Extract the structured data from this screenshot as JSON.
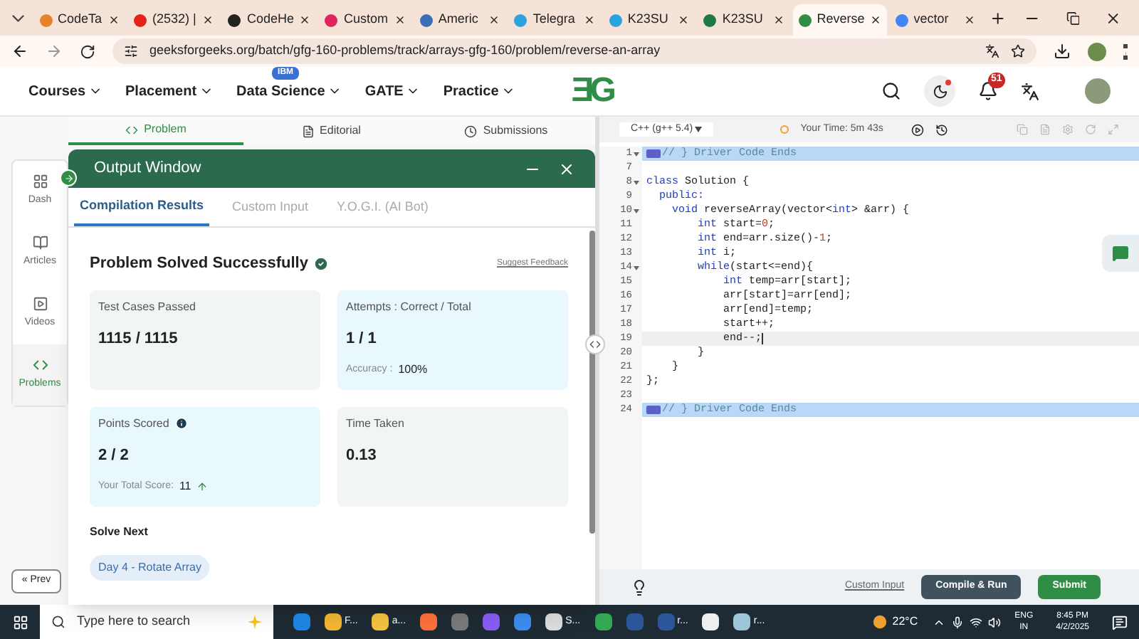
{
  "browser_tabs": [
    {
      "label": "CodeTa",
      "color": "#e8822a",
      "selected": false
    },
    {
      "label": "(2532) |",
      "color": "#e62117",
      "selected": false
    },
    {
      "label": "CodeHe",
      "color": "#222222",
      "selected": false
    },
    {
      "label": "Custom",
      "color": "#e0245e",
      "selected": false
    },
    {
      "label": "Americ",
      "color": "#3a6fb5",
      "selected": false
    },
    {
      "label": "Telegra",
      "color": "#2aa3df",
      "selected": false
    },
    {
      "label": "K23SU",
      "color": "#2aa3df",
      "selected": false
    },
    {
      "label": "K23SU",
      "color": "#1d7a45",
      "selected": false
    },
    {
      "label": "Reverse",
      "color": "#2f8d46",
      "selected": true
    },
    {
      "label": "vector",
      "color": "#4285f4",
      "selected": false
    }
  ],
  "address": "geeksforgeeks.org/batch/gfg-160-problems/track/arrays-gfg-160/problem/reverse-an-array",
  "site_nav": [
    {
      "label": "Courses"
    },
    {
      "label": "Placement"
    },
    {
      "label": "Data Science",
      "badge": "IBM"
    },
    {
      "label": "GATE"
    },
    {
      "label": "Practice"
    }
  ],
  "logo": "ƎG",
  "notifications": "51",
  "problem_tabs": [
    {
      "label": "Problem",
      "selected": true
    },
    {
      "label": "Editorial",
      "selected": false
    },
    {
      "label": "Submissions",
      "selected": false
    }
  ],
  "sidebar": [
    {
      "label": "Dash",
      "selected": false
    },
    {
      "label": "Articles",
      "selected": false
    },
    {
      "label": "Videos",
      "selected": false
    },
    {
      "label": "Problems",
      "selected": true
    }
  ],
  "prev_button": "« Prev",
  "output_window": {
    "title": "Output Window",
    "tabs": [
      {
        "label": "Compilation Results",
        "selected": true
      },
      {
        "label": "Custom Input",
        "selected": false
      },
      {
        "label": "Y.O.G.I. (AI Bot)",
        "selected": false
      }
    ],
    "heading": "Problem Solved Successfully",
    "feedback_link": "Suggest Feedback",
    "cards": [
      {
        "title": "Test Cases Passed",
        "value": "1115 / 1115",
        "color": "#f1f6f4"
      },
      {
        "title": "Attempts : Correct / Total",
        "value": "1 / 1",
        "footer_label": "Accuracy :",
        "footer_value": "100%",
        "color": "#e8f8fc"
      },
      {
        "title": "Points Scored",
        "info": true,
        "value": "2 / 2",
        "footer_label": "Your Total Score:",
        "footer_value": "11",
        "trend_up": true,
        "color": "#e8f8fc"
      },
      {
        "title": "Time Taken",
        "value": "0.13",
        "color": "#f1f6f4"
      }
    ],
    "solve_next_heading": "Solve Next",
    "solve_next": [
      "Day 4 - Rotate Array"
    ]
  },
  "editor": {
    "language": "C++ (g++ 5.4)",
    "timer": "Your Time: 5m 43s",
    "lines": [
      {
        "number": "1",
        "fold": true,
        "highlighted": true,
        "active": false,
        "segments": [
          {
            "text": "// } Driver Code Ends",
            "kind": "comment"
          }
        ]
      },
      {
        "number": "7",
        "fold": false,
        "highlighted": false,
        "active": false
      },
      {
        "number": "8",
        "fold": true,
        "highlighted": false,
        "active": false,
        "segments": [
          {
            "text": "class",
            "kind": "keyword"
          },
          {
            "text": " Solution {",
            "kind": "plain"
          }
        ]
      },
      {
        "number": "9",
        "fold": false,
        "highlighted": false,
        "active": false,
        "segments": [
          {
            "text": "  public:",
            "kind": "keyword"
          }
        ]
      },
      {
        "number": "10",
        "fold": true,
        "highlighted": false,
        "active": false,
        "segments": [
          {
            "text": "    void",
            "kind": "keyword"
          },
          {
            "text": " reverseArray(vector<",
            "kind": "plain"
          },
          {
            "text": "int",
            "kind": "keyword"
          },
          {
            "text": "> &arr) {",
            "kind": "plain"
          }
        ]
      },
      {
        "number": "11",
        "fold": false,
        "highlighted": false,
        "active": false,
        "segments": [
          {
            "text": "        int",
            "kind": "keyword"
          },
          {
            "text": " start=",
            "kind": "plain"
          },
          {
            "text": "0",
            "kind": "number"
          },
          {
            "text": ";",
            "kind": "plain"
          }
        ]
      },
      {
        "number": "12",
        "fold": false,
        "highlighted": false,
        "active": false,
        "segments": [
          {
            "text": "        int",
            "kind": "keyword"
          },
          {
            "text": " end=arr.size()-",
            "kind": "plain"
          },
          {
            "text": "1",
            "kind": "number"
          },
          {
            "text": ";",
            "kind": "plain"
          }
        ]
      },
      {
        "number": "13",
        "fold": false,
        "highlighted": false,
        "active": false,
        "segments": [
          {
            "text": "        int",
            "kind": "keyword"
          },
          {
            "text": " i;",
            "kind": "plain"
          }
        ]
      },
      {
        "number": "14",
        "fold": true,
        "highlighted": false,
        "active": false,
        "segments": [
          {
            "text": "        while",
            "kind": "keyword"
          },
          {
            "text": "(start<=end){",
            "kind": "plain"
          }
        ]
      },
      {
        "number": "15",
        "fold": false,
        "highlighted": false,
        "active": false,
        "segments": [
          {
            "text": "            int",
            "kind": "keyword"
          },
          {
            "text": " temp=arr[start];",
            "kind": "plain"
          }
        ]
      },
      {
        "number": "16",
        "fold": false,
        "highlighted": false,
        "active": false,
        "segments": [
          {
            "text": "            arr[start]=arr[end];",
            "kind": "plain"
          }
        ]
      },
      {
        "number": "17",
        "fold": false,
        "highlighted": false,
        "active": false,
        "segments": [
          {
            "text": "            arr[end]=temp;",
            "kind": "plain"
          }
        ]
      },
      {
        "number": "18",
        "fold": false,
        "highlighted": false,
        "active": false,
        "segments": [
          {
            "text": "            start++;",
            "kind": "plain"
          }
        ]
      },
      {
        "number": "19",
        "fold": false,
        "highlighted": false,
        "active": true,
        "segments": [
          {
            "text": "            end--;",
            "kind": "plain"
          }
        ]
      },
      {
        "number": "20",
        "fold": false,
        "highlighted": false,
        "active": false,
        "segments": [
          {
            "text": "        }",
            "kind": "plain"
          }
        ]
      },
      {
        "number": "21",
        "fold": false,
        "highlighted": false,
        "active": false,
        "segments": [
          {
            "text": "    }",
            "kind": "plain"
          }
        ]
      },
      {
        "number": "22",
        "fold": false,
        "highlighted": false,
        "active": false,
        "segments": [
          {
            "text": "};",
            "kind": "plain"
          }
        ]
      },
      {
        "number": "23",
        "fold": false,
        "highlighted": false,
        "active": false
      },
      {
        "number": "24",
        "fold": false,
        "highlighted": true,
        "active": false,
        "segments": [
          {
            "text": "// } Driver Code Ends",
            "kind": "comment"
          }
        ]
      }
    ],
    "custom_input": "Custom Input",
    "compile_button": "Compile & Run",
    "submit_button": "Submit"
  },
  "taskbar": {
    "search_placeholder": "Type here to search",
    "apps": [
      {
        "color": "#1e88e5"
      },
      {
        "label": "F...",
        "color": "#f2b632"
      },
      {
        "label": "a...",
        "color": "#f5c342"
      },
      {
        "color": "#ff7139"
      },
      {
        "color": "#7a7a7a"
      },
      {
        "color": "#8a5cf5"
      },
      {
        "color": "#3c8cf0"
      },
      {
        "label": "S...",
        "color": "#dddddd"
      },
      {
        "color": "#34a853"
      },
      {
        "color": "#2b579a"
      },
      {
        "label": "r...",
        "color": "#2b579a"
      },
      {
        "color": "#eeeeee"
      },
      {
        "label": "r...",
        "color": "#9ec6d9"
      }
    ],
    "temperature": "22°C",
    "language": "ENG",
    "region": "IN",
    "time": "8:45 PM",
    "date": "4/2/2025"
  }
}
